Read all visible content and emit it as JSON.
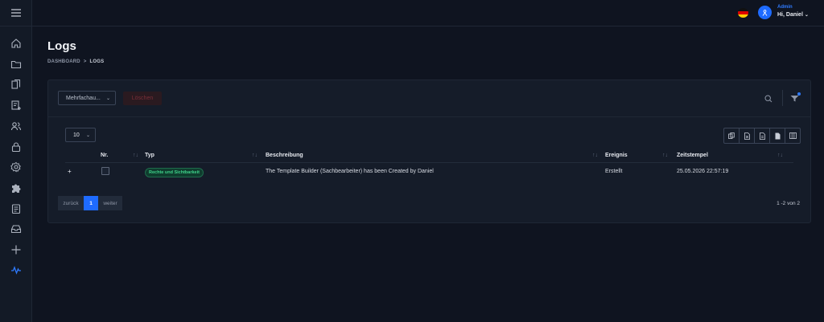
{
  "topbar": {
    "role": "Admin",
    "greeting": "Hi, Daniel",
    "language_flag": "de-flag-icon"
  },
  "page": {
    "title": "Logs",
    "breadcrumb": [
      "DASHBOARD",
      "LOGS"
    ]
  },
  "toolbar": {
    "bulk_select_value": "Mehrfachau...",
    "delete_label": "Löschen"
  },
  "table": {
    "page_length": "10",
    "columns": [
      "Nr.",
      "Typ",
      "Beschreibung",
      "Ereignis",
      "Zeitstempel"
    ],
    "rows": [
      {
        "expand": "+",
        "type": "Rechte und Sichtbarkeit",
        "description": "The Template Builder (Sachbearbeiter) has been Created by Daniel",
        "event": "Erstellt",
        "timestamp": "25.05.2026 22:57:19"
      }
    ]
  },
  "pagination": {
    "prev_label": "zurück",
    "current_page": "1",
    "next_label": "weiter",
    "info": "1 -2 von 2"
  },
  "colors": {
    "background": "#0f1420",
    "card": "#151c29",
    "accent": "#1e6bff",
    "badge_green": "#3fd28a",
    "danger": "#7a2e38"
  }
}
